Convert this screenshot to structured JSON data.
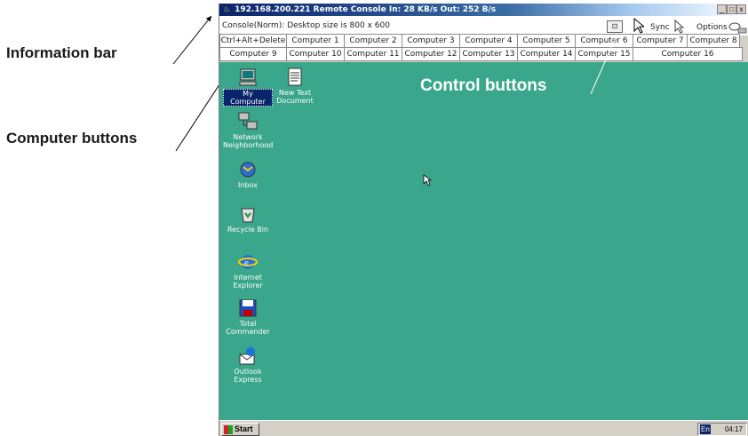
{
  "annotations": {
    "information_bar": "Information bar",
    "computer_buttons": "Computer buttons",
    "control_buttons": "Control buttons"
  },
  "window": {
    "title": "192.168.200.221 Remote Console In: 28 KB/s Out: 252 B/s",
    "min_label": "_",
    "max_label": "□",
    "close_label": "x"
  },
  "info_bar": {
    "text": "Console(Norm): Desktop size is 800 x 600",
    "sync_label": "Sync",
    "options_label": "Options"
  },
  "computer_buttons": {
    "row1": [
      "Ctrl+Alt+Delete",
      "Computer 1",
      "Computer 2",
      "Computer 3",
      "Computer 4",
      "Computer 5",
      "Computer 6",
      "Computer 7",
      "Computer 8"
    ],
    "row2": [
      "Computer 9",
      "Computer 10",
      "Computer 11",
      "Computer 12",
      "Computer 13",
      "Computer 14",
      "Computer 15",
      "Computer 16"
    ]
  },
  "desktop": {
    "icons": [
      {
        "label": "My Computer",
        "icon": "computer-icon"
      },
      {
        "label": "New Text Document",
        "icon": "text-document-icon"
      },
      {
        "label": "Network Neighborhood",
        "icon": "network-icon"
      },
      {
        "label": "Inbox",
        "icon": "inbox-icon"
      },
      {
        "label": "Recycle Bin",
        "icon": "recycle-bin-icon"
      },
      {
        "label": "Internet Explorer",
        "icon": "internet-explorer-icon"
      },
      {
        "label": "Total Commander",
        "icon": "total-commander-icon"
      },
      {
        "label": "Outlook Express",
        "icon": "outlook-express-icon"
      }
    ]
  },
  "taskbar": {
    "start_label": "Start",
    "lang": "En",
    "clock": "04:17"
  },
  "colors": {
    "desktop": "#3aa68b",
    "titlebar": "#0a246a",
    "chrome": "#d4d0c8"
  }
}
